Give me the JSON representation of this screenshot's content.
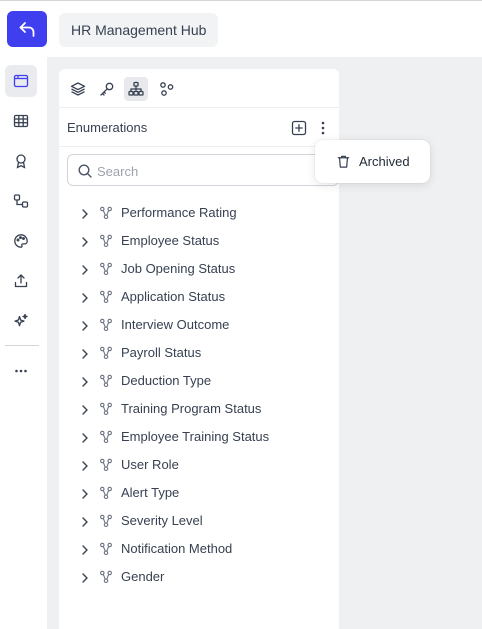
{
  "header": {
    "back_icon": "undo-arrow-icon",
    "project_name": "HR Management Hub"
  },
  "rail": {
    "items": [
      {
        "name": "editor",
        "icon": "window-icon",
        "active": true
      },
      {
        "name": "tables",
        "icon": "table-grid-icon",
        "active": false
      },
      {
        "name": "badges",
        "icon": "award-icon",
        "active": false
      },
      {
        "name": "relations",
        "icon": "relations-icon",
        "active": false
      },
      {
        "name": "themes",
        "icon": "palette-icon",
        "active": false
      },
      {
        "name": "export",
        "icon": "upload-icon",
        "active": false
      },
      {
        "name": "ai",
        "icon": "sparkles-icon",
        "active": false
      },
      {
        "name": "more",
        "icon": "more-horizontal-icon",
        "active": false
      }
    ]
  },
  "panel": {
    "tabs": [
      {
        "name": "layers",
        "icon": "layers-icon",
        "active": false
      },
      {
        "name": "keys",
        "icon": "key-icon",
        "active": false
      },
      {
        "name": "hierarchy",
        "icon": "hierarchy-icon",
        "active": true
      },
      {
        "name": "nodes",
        "icon": "nodes-icon",
        "active": false
      }
    ],
    "title": "Enumerations",
    "search": {
      "placeholder": "Search",
      "value": ""
    },
    "enumerations": [
      "Performance Rating",
      "Employee Status",
      "Job Opening Status",
      "Application Status",
      "Interview Outcome",
      "Payroll Status",
      "Deduction Type",
      "Training Program Status",
      "Employee Training Status",
      "User Role",
      "Alert Type",
      "Severity Level",
      "Notification Method",
      "Gender"
    ]
  },
  "popover": {
    "item_label": "Archived",
    "item_icon": "trash-icon"
  },
  "colors": {
    "accent": "#3f3ff0",
    "workspace_bg": "#eef0f2"
  }
}
